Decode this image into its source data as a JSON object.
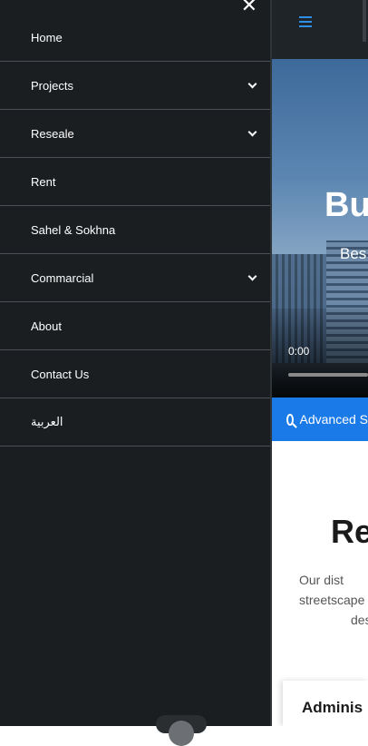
{
  "drawer": {
    "close_icon": "close-icon",
    "items": [
      {
        "label": "Home",
        "has_submenu": false
      },
      {
        "label": "Projects",
        "has_submenu": true
      },
      {
        "label": "Reseale",
        "has_submenu": true
      },
      {
        "label": "Rent",
        "has_submenu": false
      },
      {
        "label": "Sahel & Sokhna",
        "has_submenu": false
      },
      {
        "label": "Commarcial",
        "has_submenu": true
      },
      {
        "label": "About",
        "has_submenu": false
      },
      {
        "label": "Contact Us",
        "has_submenu": false
      },
      {
        "label": "العربية",
        "has_submenu": false
      }
    ]
  },
  "page": {
    "hero_title": "Bu",
    "hero_subtitle": "Bes",
    "video_time": "0:00",
    "advanced_search_label": "Advanced S",
    "section_heading": "Re",
    "section_text": [
      "Our dist",
      "streetscape",
      "des"
    ],
    "card_title": "Adminis"
  },
  "colors": {
    "drawer_bg": "#1a1e21",
    "accent": "#1a7ae8",
    "hamburger": "#2f8fe8"
  }
}
